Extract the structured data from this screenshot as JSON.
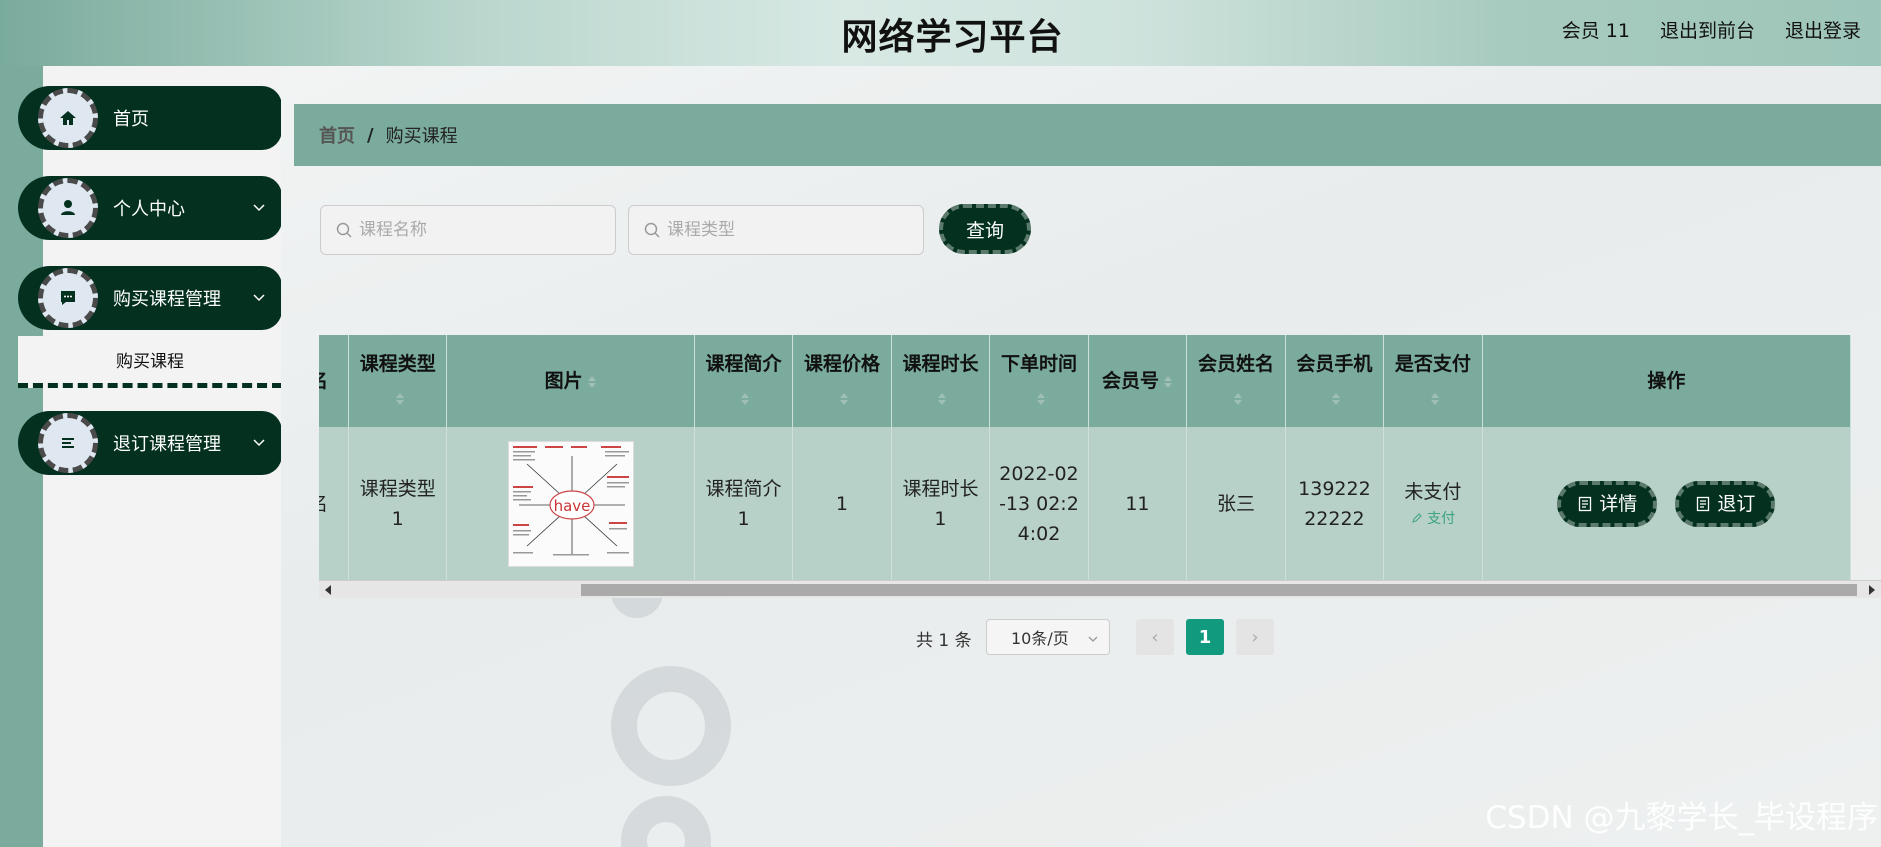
{
  "header": {
    "title": "网络学习平台",
    "member": "会员 11",
    "exit_front": "退出到前台",
    "logout": "退出登录"
  },
  "sidebar": {
    "items": [
      {
        "label": "首页",
        "icon": "home-icon"
      },
      {
        "label": "个人中心",
        "icon": "user-icon"
      },
      {
        "label": "购买课程管理",
        "icon": "message-icon"
      },
      {
        "label": "退订课程管理",
        "icon": "list-icon"
      }
    ],
    "submenu_item": "购买课程"
  },
  "breadcrumb": {
    "home": "首页",
    "separator": "/",
    "current": "购买课程"
  },
  "search": {
    "course_name_placeholder": "课程名称",
    "course_type_placeholder": "课程类型",
    "query_label": "查询"
  },
  "table": {
    "headers": [
      "名",
      "课程类型",
      "图片",
      "课程简介",
      "课程价格",
      "课程时长",
      "下单时间",
      "会员号",
      "会员姓名",
      "会员手机",
      "是否支付",
      "操作"
    ],
    "row": {
      "name": "名",
      "course_type": "课程类型1",
      "image_text": "have",
      "intro": "课程简介1",
      "price": "1",
      "duration": "课程时长1",
      "order_time": "2022-02-13 02:24:02",
      "member_no": "11",
      "member_name": "张三",
      "member_phone": "13922222222",
      "paid": "未支付",
      "pay_link": "支付",
      "detail_btn": "详情",
      "unsubscribe_btn": "退订"
    }
  },
  "pager": {
    "total": "共 1 条",
    "page_size": "10条/页",
    "current": "1",
    "prev": "‹",
    "next": "›"
  },
  "watermark": "CSDN @九黎学长_毕设程序",
  "colors": {
    "accent": "#7aab9c",
    "dark": "#03301f",
    "pager_active": "#119a7e"
  }
}
